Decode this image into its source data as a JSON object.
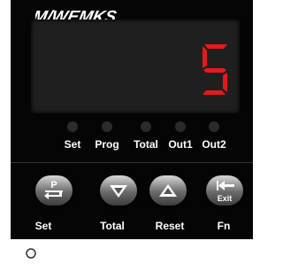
{
  "brand": "M-WEMKS",
  "display": {
    "value": "5",
    "color": "#e41a1a"
  },
  "indicators": [
    {
      "label": "Set",
      "state": "off"
    },
    {
      "label": "Prog",
      "state": "off"
    },
    {
      "label": "Total",
      "state": "off"
    },
    {
      "label": "Out1",
      "state": "off"
    },
    {
      "label": "Out2",
      "state": "off"
    }
  ],
  "keys": [
    {
      "symbol_top": "P",
      "label": "Set",
      "icon": "program-enter-icon"
    },
    {
      "label": "Total",
      "icon": "down-arrow-icon"
    },
    {
      "label": "Reset",
      "icon": "up-arrow-icon"
    },
    {
      "symbol_bottom": "Exit",
      "label": "Fn",
      "icon": "exit-icon"
    }
  ]
}
